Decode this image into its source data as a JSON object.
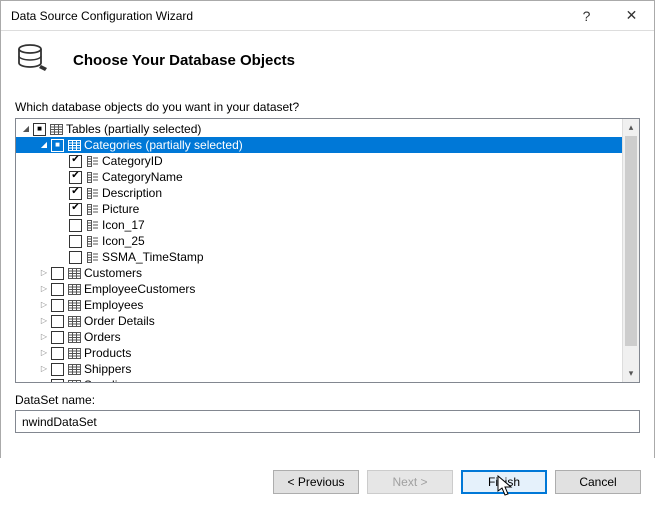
{
  "window": {
    "title": "Data Source Configuration Wizard",
    "help_btn": "?",
    "close_btn": "✕"
  },
  "header": {
    "title": "Choose Your Database Objects"
  },
  "content": {
    "prompt": "Which database objects do you want in your dataset?",
    "dataset_label": "DataSet name:",
    "dataset_value": "nwindDataSet"
  },
  "tree": {
    "root": {
      "label": "Tables (partially selected)",
      "state": "partial",
      "expand": "open",
      "indent": 0,
      "icon": "table",
      "selected": false
    },
    "categories_node": {
      "label": "Categories (partially selected)",
      "state": "partial",
      "expand": "open",
      "indent": 1,
      "icon": "table",
      "selected": true
    },
    "columns": [
      {
        "label": "CategoryID",
        "state": "checked",
        "indent": 2,
        "icon": "column"
      },
      {
        "label": "CategoryName",
        "state": "checked",
        "indent": 2,
        "icon": "column"
      },
      {
        "label": "Description",
        "state": "checked",
        "indent": 2,
        "icon": "column"
      },
      {
        "label": "Picture",
        "state": "checked",
        "indent": 2,
        "icon": "column"
      },
      {
        "label": "Icon_17",
        "state": "unchecked",
        "indent": 2,
        "icon": "column"
      },
      {
        "label": "Icon_25",
        "state": "unchecked",
        "indent": 2,
        "icon": "column"
      },
      {
        "label": "SSMA_TimeStamp",
        "state": "unchecked",
        "indent": 2,
        "icon": "column"
      }
    ],
    "tables": [
      {
        "label": "Customers",
        "state": "unchecked",
        "expand": "closed",
        "indent": 1,
        "icon": "table"
      },
      {
        "label": "EmployeeCustomers",
        "state": "unchecked",
        "expand": "closed",
        "indent": 1,
        "icon": "table"
      },
      {
        "label": "Employees",
        "state": "unchecked",
        "expand": "closed",
        "indent": 1,
        "icon": "table"
      },
      {
        "label": "Order Details",
        "state": "unchecked",
        "expand": "closed",
        "indent": 1,
        "icon": "table"
      },
      {
        "label": "Orders",
        "state": "unchecked",
        "expand": "closed",
        "indent": 1,
        "icon": "table"
      },
      {
        "label": "Products",
        "state": "unchecked",
        "expand": "closed",
        "indent": 1,
        "icon": "table"
      },
      {
        "label": "Shippers",
        "state": "unchecked",
        "expand": "closed",
        "indent": 1,
        "icon": "table"
      },
      {
        "label": "Suppliers",
        "state": "unchecked",
        "expand": "closed",
        "indent": 1,
        "icon": "table"
      }
    ]
  },
  "buttons": {
    "previous": "< Previous",
    "next": "Next >",
    "finish": "Finish",
    "cancel": "Cancel"
  }
}
